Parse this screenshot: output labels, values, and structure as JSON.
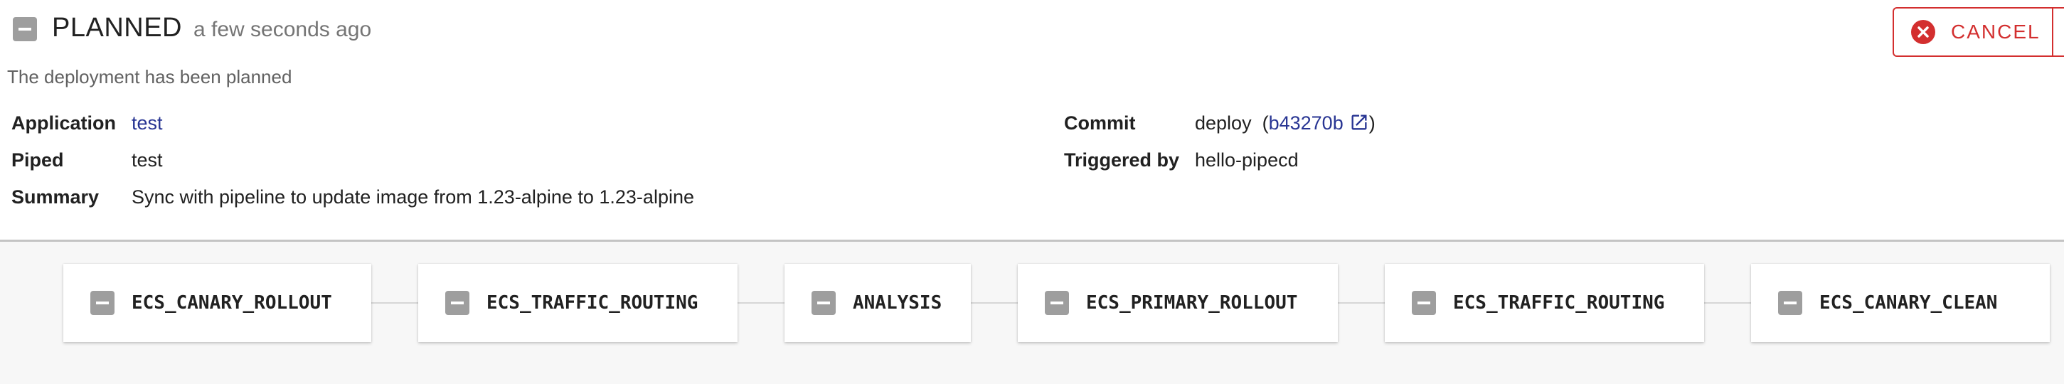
{
  "header": {
    "status": "PLANNED",
    "time": "a few seconds ago",
    "description": "The deployment has been planned",
    "cancel_label": "CANCEL"
  },
  "details": {
    "application": {
      "label": "Application",
      "value": "test"
    },
    "piped": {
      "label": "Piped",
      "value": "test"
    },
    "summary": {
      "label": "Summary",
      "value": "Sync with pipeline to update image from 1.23-alpine to 1.23-alpine"
    },
    "commit": {
      "label": "Commit",
      "message": "deploy",
      "open_paren": "(",
      "hash": "b43270b",
      "close_paren": ")"
    },
    "triggered_by": {
      "label": "Triggered by",
      "value": "hello-pipecd"
    }
  },
  "pipeline": {
    "stages": [
      {
        "name": "ECS_CANARY_ROLLOUT",
        "status": "not-started"
      },
      {
        "name": "ECS_TRAFFIC_ROUTING",
        "status": "not-started"
      },
      {
        "name": "ANALYSIS",
        "status": "not-started"
      },
      {
        "name": "ECS_PRIMARY_ROLLOUT",
        "status": "not-started"
      },
      {
        "name": "ECS_TRAFFIC_ROUTING",
        "status": "not-started"
      },
      {
        "name": "ECS_CANARY_CLEAN",
        "status": "not-started"
      }
    ]
  },
  "colors": {
    "status_gray": "#9e9e9e",
    "cancel_red": "#d32f2f",
    "link_blue": "#283593"
  },
  "icons": {
    "status": "minus-square-icon",
    "cancel": "cancel-circle-icon",
    "commit_link": "open-in-new-icon"
  }
}
